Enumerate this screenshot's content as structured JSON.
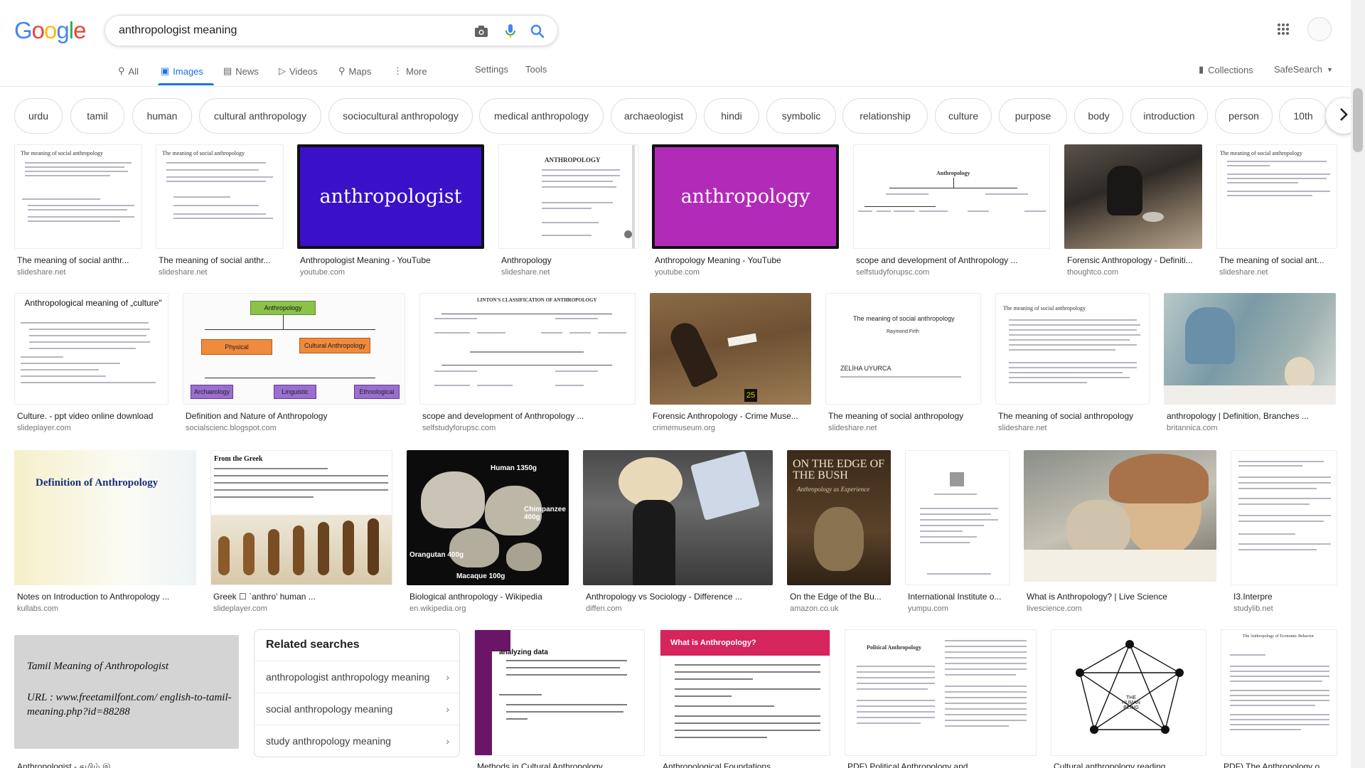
{
  "search": {
    "query": "anthropologist meaning"
  },
  "logo": "Google",
  "tabs": [
    {
      "label": "All",
      "icon": "search-icon"
    },
    {
      "label": "Images",
      "icon": "image-icon"
    },
    {
      "label": "News",
      "icon": "news-icon"
    },
    {
      "label": "Videos",
      "icon": "video-icon"
    },
    {
      "label": "Maps",
      "icon": "map-pin-icon"
    },
    {
      "label": "More",
      "icon": "more-vert-icon"
    }
  ],
  "tools": {
    "settings": "Settings",
    "tools": "Tools",
    "collections": "Collections",
    "safesearch": "SafeSearch"
  },
  "chips": [
    "urdu",
    "tamil",
    "human",
    "cultural anthropology",
    "sociocultural anthropology",
    "medical anthropology",
    "archaeologist",
    "hindi",
    "symbolic",
    "relationship",
    "culture",
    "purpose",
    "body",
    "introduction",
    "person",
    "10th"
  ],
  "row1": [
    {
      "caption": "The meaning of social anthr...",
      "source": "slideshare.net",
      "thumb_title": "The meaning of social anthropology"
    },
    {
      "caption": "The meaning of social anthr...",
      "source": "slideshare.net",
      "thumb_title": "The meaning of social anthropology"
    },
    {
      "caption": "Anthropologist Meaning - YouTube",
      "source": "youtube.com",
      "thumb_title": "anthropologist"
    },
    {
      "caption": "Anthropology",
      "source": "slideshare.net",
      "thumb_title": "ANTHROPOLOGY"
    },
    {
      "caption": "Anthropology Meaning - YouTube",
      "source": "youtube.com",
      "thumb_title": "anthropology"
    },
    {
      "caption": "scope and development of Anthropology ...",
      "source": "selfstudyforupsc.com",
      "thumb_title": "Anthropology"
    },
    {
      "caption": "Forensic Anthropology - Definiti...",
      "source": "thoughtco.com",
      "thumb_title": ""
    },
    {
      "caption": "The meaning of social ant...",
      "source": "slideshare.net",
      "thumb_title": "The meaning of social anthropology"
    }
  ],
  "row2": [
    {
      "caption": "Culture. - ppt video online download",
      "source": "slideplayer.com",
      "thumb_title": "Anthropological meaning of „culture\""
    },
    {
      "caption": "Definition and Nature of Anthropology",
      "source": "socialscienc.blogspot.com",
      "thumb_title": "Anthropology",
      "nodes": [
        "Physical",
        "Cultural Anthropology",
        "Archaeology",
        "Linguistic",
        "Ethnological"
      ]
    },
    {
      "caption": "scope and development of Anthropology ...",
      "source": "selfstudyforupsc.com",
      "thumb_title": "LINTON'S CLASSIFICATION OF ANTHROPOLOGY"
    },
    {
      "caption": "Forensic Anthropology - Crime Muse...",
      "source": "crimemuseum.org",
      "thumb_title": ""
    },
    {
      "caption": "The meaning of social anthropology",
      "source": "slideshare.net",
      "thumb_title": "The meaning of social anthropology",
      "thumb_author": "Raymond Firth",
      "thumb_name": "ZELİHA UYURCA"
    },
    {
      "caption": "The meaning of social anthropology",
      "source": "slideshare.net",
      "thumb_title": "The meaning of social anthropology"
    },
    {
      "caption": "anthropology | Definition, Branches ...",
      "source": "britannica.com",
      "thumb_title": ""
    }
  ],
  "row3": [
    {
      "caption": "Notes on Introduction to Anthropology ...",
      "source": "kullabs.com",
      "thumb_title": "Definition of Anthropology"
    },
    {
      "caption": "Greek ☐ `anthro' human ...",
      "source": "slideplayer.com",
      "thumb_title": "From the Greek"
    },
    {
      "caption": "Biological anthropology - Wikipedia",
      "source": "en.wikipedia.org",
      "thumb_labels": [
        "Human 1350g",
        "Chimpanzee 400g",
        "Orangutan 400g",
        "Macaque 100g"
      ]
    },
    {
      "caption": "Anthropology vs Sociology - Difference ...",
      "source": "diffen.com",
      "thumb_title": ""
    },
    {
      "caption": "On the Edge of the Bu...",
      "source": "amazon.co.uk",
      "thumb_title": "ON THE EDGE OF THE BUSH",
      "thumb_subtitle": "Anthropology as Experience"
    },
    {
      "caption": "International Institute o...",
      "source": "yumpu.com",
      "thumb_title": ""
    },
    {
      "caption": "What is Anthropology? | Live Science",
      "source": "livescience.com",
      "thumb_title": ""
    },
    {
      "caption": "I3.Interpre",
      "source": "studylib.net",
      "thumb_title": ""
    }
  ],
  "row4": [
    {
      "caption": "Anthropologist - தமிழ் இ...",
      "thumb_title": "Tamil Meaning of Anthropologist",
      "thumb_url": "URL : www.freetamilfont.com/ english-to-tamil-meaning.php?id=88288"
    },
    {
      "caption": "Methods in Cultural Anthropology",
      "thumb_title": "analyzing data"
    },
    {
      "caption": "Anthropological Foundations",
      "thumb_title": "What is Anthropology?"
    },
    {
      "caption": "PDF) Political Anthropology and ...",
      "thumb_title": "Political Anthropology"
    },
    {
      "caption": "Cultural anthropology reading ...",
      "thumb_title": "THE HUMAN BEING"
    },
    {
      "caption": "PDF) The Anthropology o...",
      "thumb_title": "The Anthropology of Economic Behavior"
    }
  ],
  "related": {
    "title": "Related searches",
    "items": [
      "anthropologist anthropology meaning",
      "social anthropology meaning",
      "study anthropology meaning"
    ]
  },
  "colors": {
    "accent": "#1a73e8",
    "youtube_purple": "#3a10c8",
    "youtube_magenta": "#b22bb8"
  }
}
